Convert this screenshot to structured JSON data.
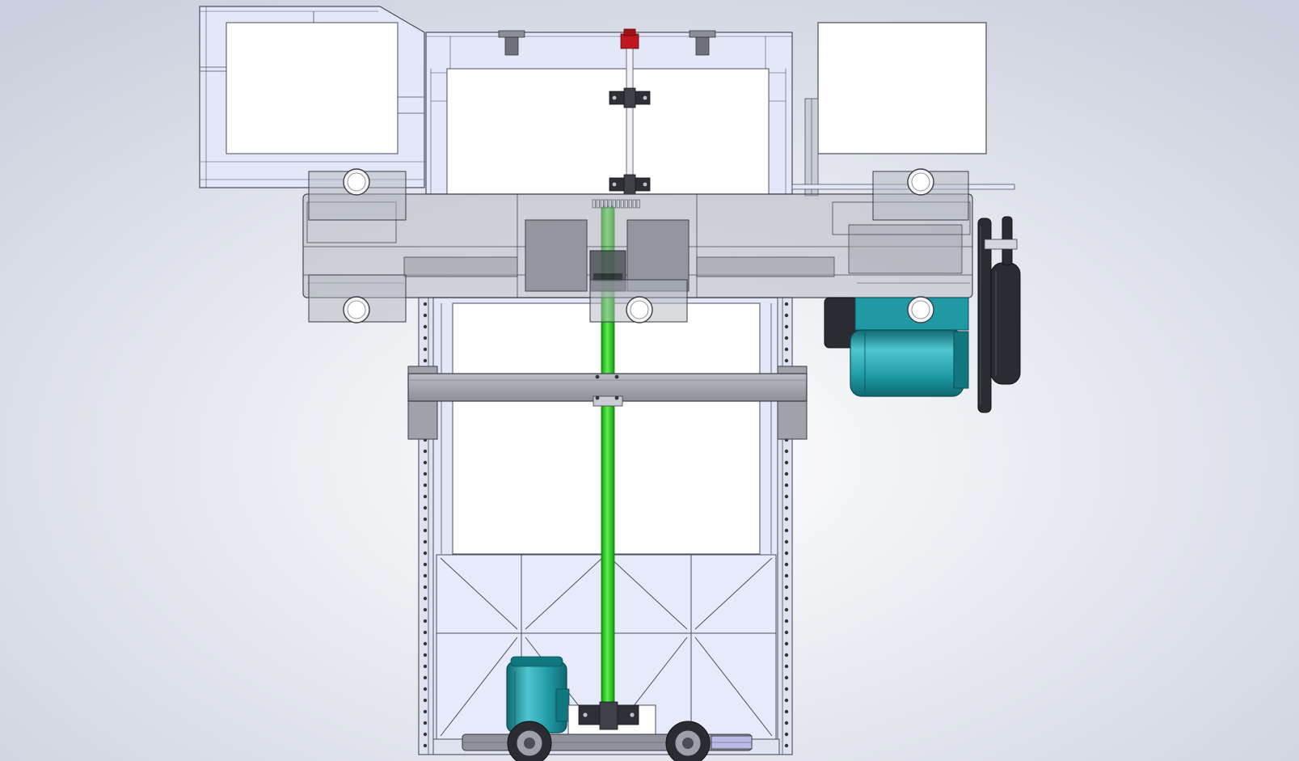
{
  "viewport": {
    "background_center": "#ffffff",
    "background_edge": "#c9cfdc"
  },
  "colors": {
    "frame_fill": "#e3e8f8",
    "frame_stroke": "#4a4d5c",
    "panel_fill": "#ffffff",
    "carriage_fill": "#b4b7bf",
    "carriage_opacity": "0.55",
    "steel_grey": "#9fa2a9",
    "dark_grey": "#7d8088",
    "shaft_green": "#22d31a",
    "shaft_green_dark": "#129a0e",
    "motor_teal": "#1f9aa5",
    "motor_teal_light": "#4fc6d0",
    "motor_teal_dark": "#0e6870",
    "wheel_dark": "#2b2c31",
    "red_fitting": "#c0161d",
    "bolt_dark": "#33353c"
  },
  "icons": {
    "main_motor": "motor-icon",
    "drive_motor": "motor-icon",
    "wheel": "wheel-icon",
    "pulley": "pulley-icon",
    "bearing": "bearing-icon"
  }
}
